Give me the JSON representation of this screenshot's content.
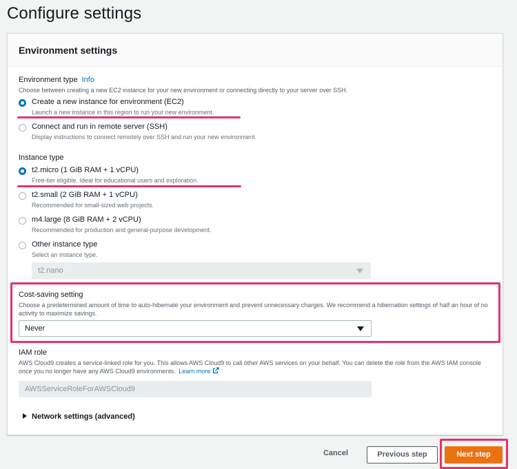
{
  "page": {
    "title": "Configure settings"
  },
  "panel": {
    "title": "Environment settings"
  },
  "environment_type": {
    "label": "Environment type",
    "info_link": "Info",
    "description": "Choose between creating a new EC2 instance for your new environment or connecting directly to your server over SSH.",
    "options": [
      {
        "label": "Create a new instance for environment (EC2)",
        "description": "Launch a new instance in this region to run your new environment.",
        "selected": true
      },
      {
        "label": "Connect and run in remote server (SSH)",
        "description": "Display instructions to connect remotely over SSH and run your new environment.",
        "selected": false
      }
    ]
  },
  "instance_type": {
    "label": "Instance type",
    "options": [
      {
        "label": "t2.micro (1 GiB RAM + 1 vCPU)",
        "description": "Free-tier eligible. Ideal for educational users and exploration.",
        "selected": true
      },
      {
        "label": "t2.small (2 GiB RAM + 1 vCPU)",
        "description": "Recommended for small-sized web projects.",
        "selected": false
      },
      {
        "label": "m4.large (8 GiB RAM + 2 vCPU)",
        "description": "Recommended for production and general-purpose development.",
        "selected": false
      },
      {
        "label": "Other instance type",
        "description": "Select an instance type.",
        "selected": false
      }
    ],
    "other_select_value": "t2.nano"
  },
  "cost_saving": {
    "label": "Cost-saving setting",
    "description": "Choose a predetermined amount of time to auto-hibernate your environment and prevent unnecessary charges. We recommend a hibernation settings of half an hour of no activity to maximize savings.",
    "value": "Never"
  },
  "iam_role": {
    "label": "IAM role",
    "description": "AWS Cloud9 creates a service-linked role for you. This allows AWS Cloud9 to call other AWS services on your behalf. You can delete the role from the AWS IAM console once you no longer have any AWS Cloud9 environments.",
    "learn_more": "Learn more",
    "value": "AWSServiceRoleForAWSCloud9"
  },
  "network": {
    "label": "Network settings (advanced)"
  },
  "footer": {
    "cancel": "Cancel",
    "previous": "Previous step",
    "next": "Next step"
  },
  "colors": {
    "accent_link": "#0073bb",
    "primary_button": "#ec7211",
    "annotation_highlight": "#e8306a"
  },
  "icons": [
    "radio-selected-icon",
    "radio-unselected-icon",
    "caret-down-icon",
    "external-link-icon",
    "expand-triangle-icon"
  ]
}
